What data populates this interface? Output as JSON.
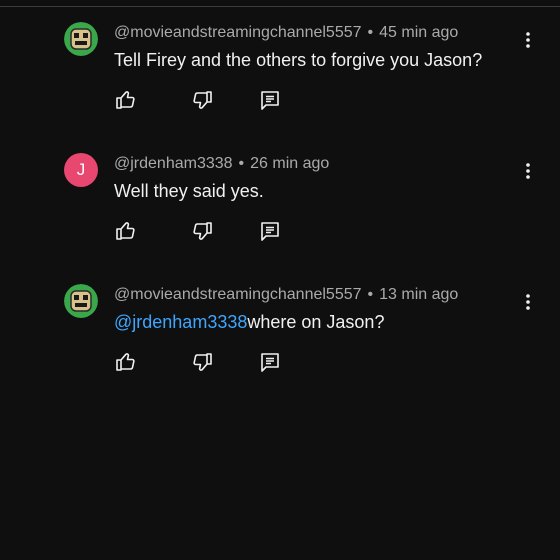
{
  "comments": [
    {
      "avatar_icon": "cartoon-character-avatar",
      "author": "@movieandstreamingchannel5557",
      "separator": "•",
      "time": "45 min ago",
      "mention": "",
      "text": "Tell Firey and the others to forgive you Jason?"
    },
    {
      "avatar_letter": "J",
      "avatar_color": "#e8476f",
      "author": "@jrdenham3338",
      "separator": "•",
      "time": "26 min ago",
      "mention": "",
      "text": "Well they said yes."
    },
    {
      "avatar_icon": "cartoon-character-avatar",
      "author": "@movieandstreamingchannel5557",
      "separator": "•",
      "time": "13 min ago",
      "mention": "@jrdenham3338",
      "text": "where on Jason?"
    }
  ],
  "icons": {
    "like": "thumbs-up-icon",
    "dislike": "thumbs-down-icon",
    "reply": "reply-icon",
    "more": "more-vert-icon"
  },
  "colors": {
    "background": "#0f0f0f",
    "text": "#f1f1f1",
    "meta": "#aaaaaa",
    "mention": "#3ea6ff"
  }
}
